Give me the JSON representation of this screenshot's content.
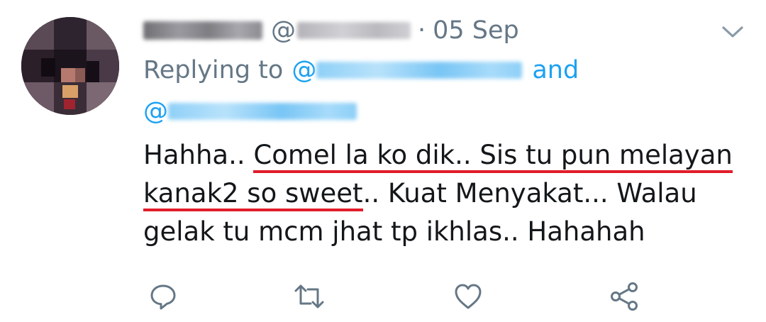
{
  "tweet": {
    "header": {
      "handle_prefix": "@",
      "separator": "·",
      "date": "05 Sep"
    },
    "reply": {
      "prefix": "Replying to",
      "at1": "@",
      "conjunction": "and",
      "at2": "@"
    },
    "body": {
      "line1_start": "Hahha.. ",
      "line1_underlined": "Comel la ko dik.. Sis tu pun melayan",
      "line2_underlined": "kanak2 so sweet",
      "line2_rest": ".. Kuat Menyakat... Walau",
      "line3": "gelak tu mcm jhat tp ikhlas.. Hahahah"
    },
    "icons": {
      "menu": "chevron-down-icon",
      "reply": "reply-icon",
      "retweet": "retweet-icon",
      "like": "heart-icon",
      "share": "share-icon"
    },
    "colors": {
      "secondary_text": "#657786",
      "link": "#1da1f2",
      "underline": "#e11d2a",
      "icon": "#657786"
    }
  }
}
